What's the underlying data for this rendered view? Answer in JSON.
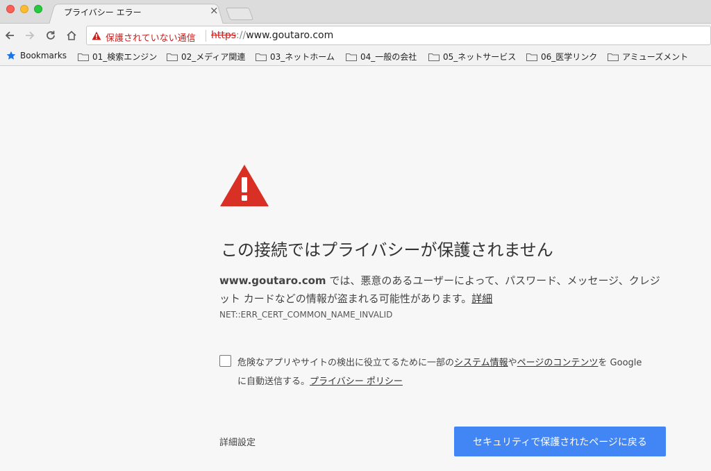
{
  "tab": {
    "title": "プライバシー エラー",
    "close": "×"
  },
  "toolbar": {
    "security_label": "保護されていない通信",
    "url_scheme": "https",
    "url_sep": "://",
    "url_host": "www.goutaro.com"
  },
  "bookmarks": {
    "star_label": "Bookmarks",
    "folders": [
      "01_検索エンジン",
      "02_メディア関連",
      "03_ネットホーム",
      "04_一般の会社",
      "05_ネットサービス",
      "06_医学リンク",
      "アミューズメント"
    ]
  },
  "content": {
    "heading": "この接続ではプライバシーが保護されません",
    "desc_domain": "www.goutaro.com",
    "desc_text": " では、悪意のあるユーザーによって、パスワード、メッセージ、クレジット カードなどの情報が盗まれる可能性があります。",
    "desc_link": "詳細",
    "error_code": "NET::ERR_CERT_COMMON_NAME_INVALID",
    "optin_text_1": "危険なアプリやサイトの検出に役立てるために一部の",
    "optin_link_1": "システム情報",
    "optin_text_2": "や",
    "optin_link_2": "ページのコンテンツ",
    "optin_text_3": "を Google に自動送信する。",
    "optin_link_3": "プライバシー ポリシー",
    "details_button": "詳細設定",
    "primary_button": "セキュリティで保護されたページに戻る"
  },
  "colors": {
    "accent": "#4285f4",
    "danger": "#d93025",
    "not_secure": "#c5221f"
  }
}
